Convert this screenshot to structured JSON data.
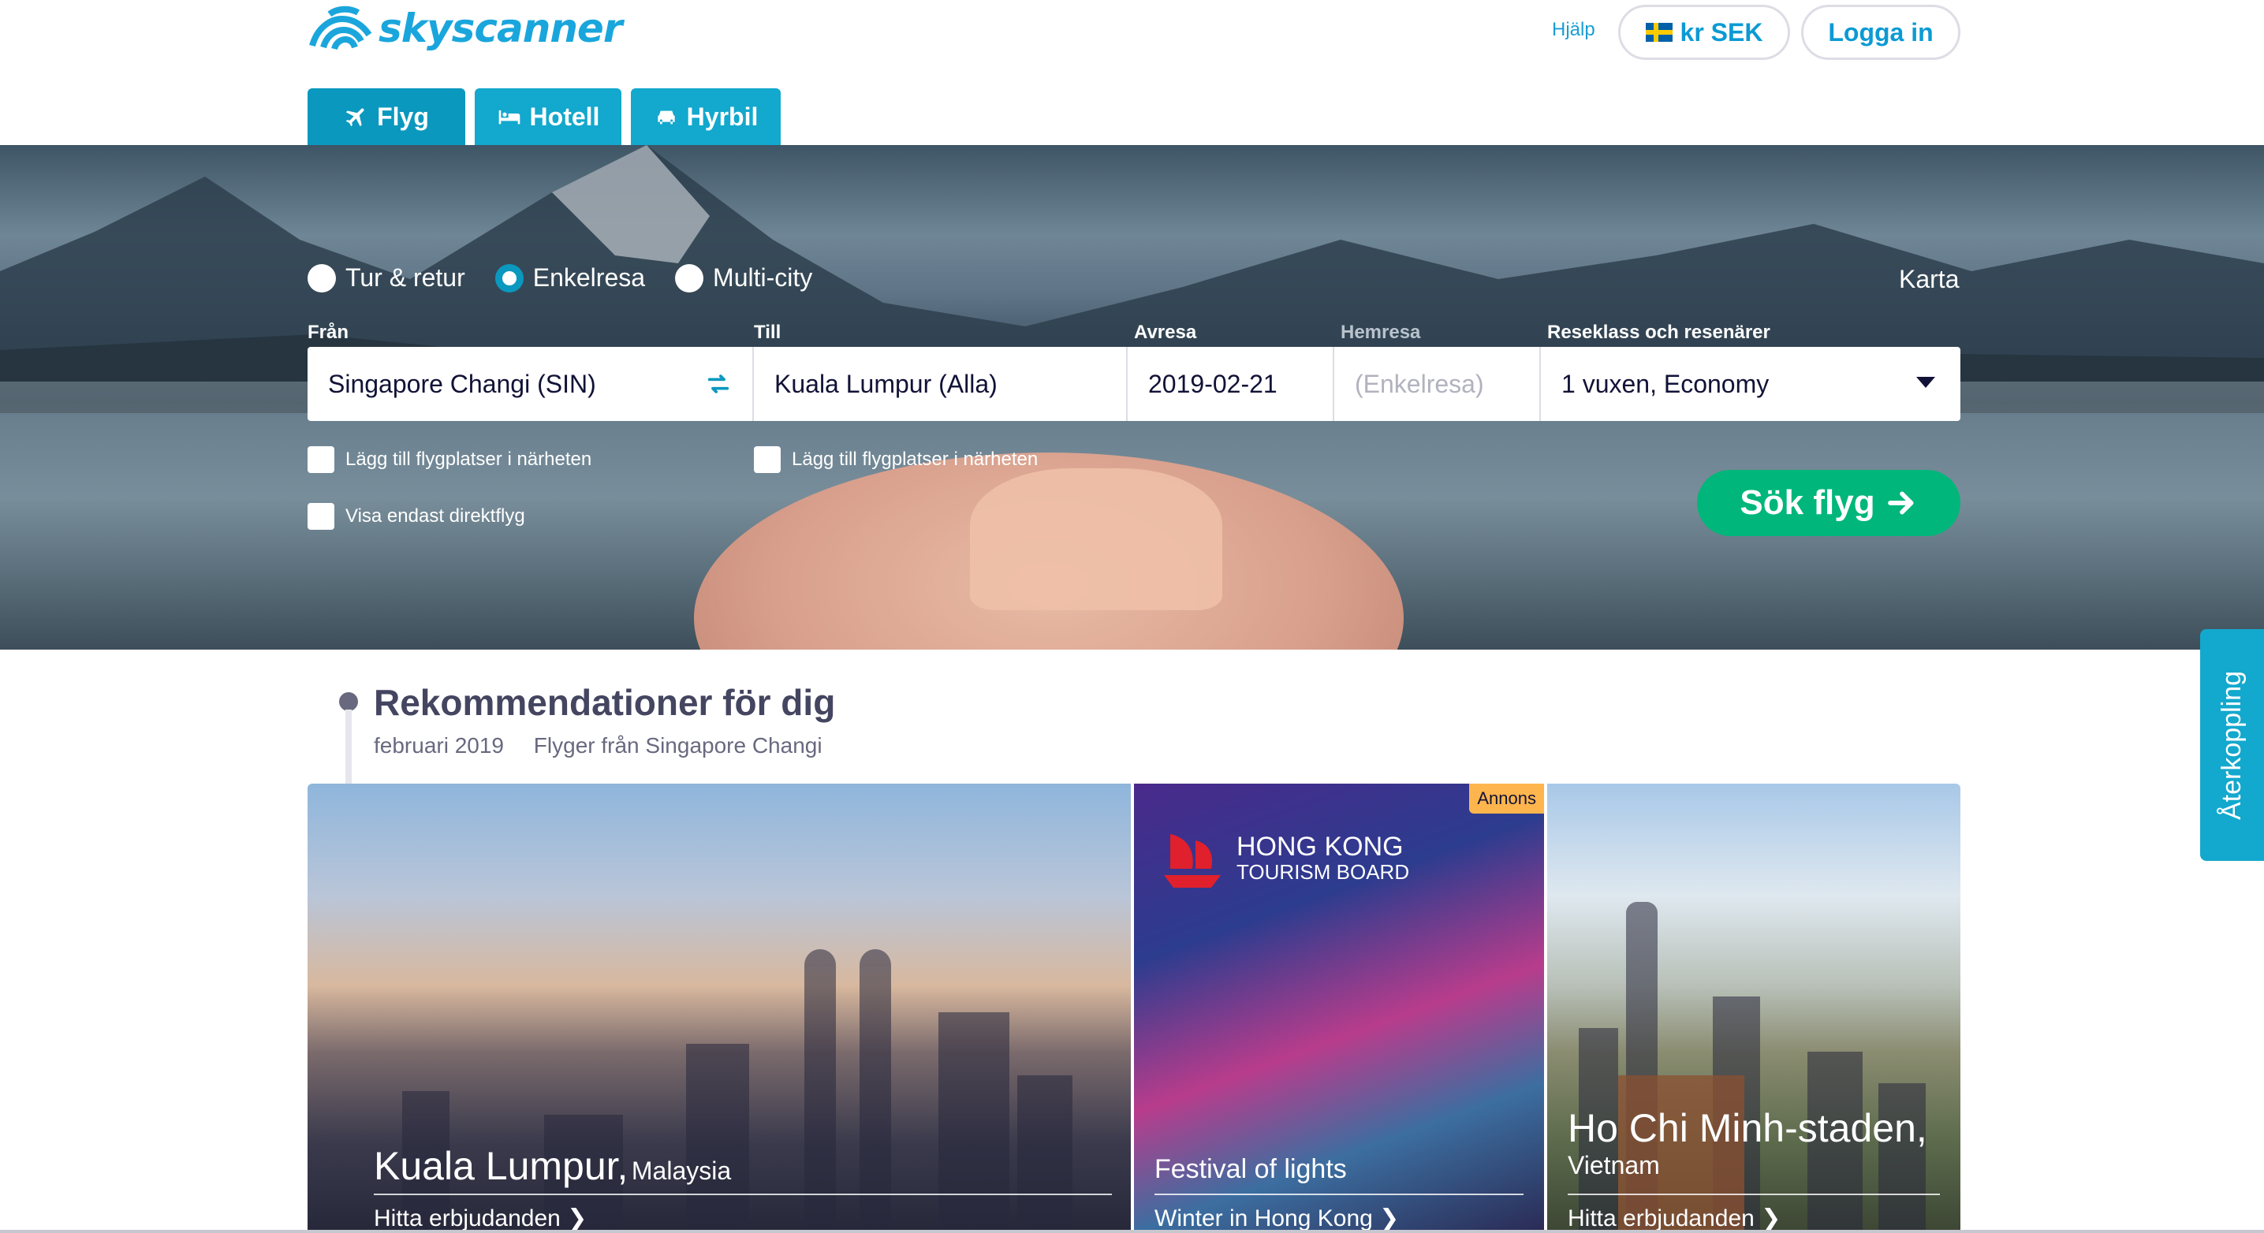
{
  "header": {
    "logo_text": "skyscanner",
    "help_label": "Hjälp",
    "currency_label": "kr SEK",
    "login_label": "Logga in",
    "tabs": [
      {
        "label": "Flyg",
        "icon": "plane-icon"
      },
      {
        "label": "Hotell",
        "icon": "bed-icon"
      },
      {
        "label": "Hyrbil",
        "icon": "car-icon"
      }
    ]
  },
  "search": {
    "trip_types": [
      {
        "label": "Tur & retur",
        "selected": false
      },
      {
        "label": "Enkelresa",
        "selected": true
      },
      {
        "label": "Multi-city",
        "selected": false
      }
    ],
    "map_label": "Karta",
    "labels": {
      "from": "Från",
      "to": "Till",
      "depart": "Avresa",
      "return": "Hemresa",
      "class": "Reseklass och resenärer"
    },
    "from_value": "Singapore Changi (SIN)",
    "to_value": "Kuala Lumpur (Alla)",
    "depart_value": "2019-02-21",
    "return_placeholder": "(Enkelresa)",
    "class_value": "1 vuxen, Economy",
    "nearby_from": "Lägg till flygplatser i närheten",
    "nearby_to": "Lägg till flygplatser i närheten",
    "direct_only": "Visa endast direktflyg",
    "search_button": "Sök flyg"
  },
  "recommendations": {
    "title": "Rekommendationer för dig",
    "month": "februari 2019",
    "origin": "Flyger från Singapore Changi",
    "cards": [
      {
        "city": "Kuala Lumpur,",
        "country": "Malaysia",
        "link": "Hitta erbjudanden"
      },
      {
        "ad_badge": "Annons",
        "brand_line1": "HONG KONG",
        "brand_line2": "TOURISM BOARD",
        "title": "Festival of lights",
        "link": "Winter in Hong Kong"
      },
      {
        "city": "Ho Chi Minh-staden,",
        "country": "Vietnam",
        "link": "Hitta erbjudanden"
      }
    ]
  },
  "feedback_label": "Återkoppling",
  "colors": {
    "brand": "#0b98bf",
    "tab": "#13a8cd",
    "search_button": "#00b67a",
    "ad_badge": "#ffb54d"
  }
}
